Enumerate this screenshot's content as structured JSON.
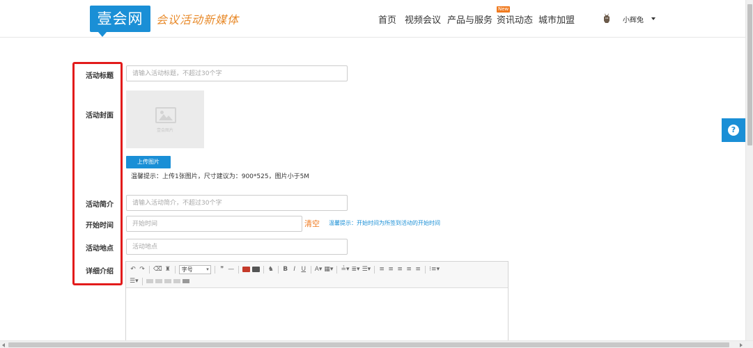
{
  "header": {
    "logo_text": "壹会网",
    "slogan": "会议活动新媒体",
    "nav": {
      "home": "首页",
      "video": "视频会议",
      "product": "产品与服务",
      "news": "资讯动态",
      "news_badge": "New",
      "city": "城市加盟"
    },
    "user": {
      "name": "小辉兔"
    }
  },
  "form": {
    "title_label": "活动标题",
    "title_placeholder": "请输入活动标题，不超过30个字",
    "cover_label": "活动封面",
    "cover_placeholder_text": "壹会图片",
    "upload_button": "上传图片",
    "upload_tip": "温馨提示：上传1张图片，尺寸建议为：900*525，图片小于5M",
    "intro_label": "活动简介",
    "intro_placeholder": "请输入活动简介，不超过30个字",
    "start_label": "开始时间",
    "start_placeholder": "开始时间",
    "clear_link": "清空",
    "start_tip": "温馨提示：开始时间为所签到活动的开始时间",
    "place_label": "活动地点",
    "place_placeholder": "活动地点",
    "detail_label": "详细介绍"
  },
  "editor": {
    "font_size_select": "字号",
    "toolbar_icons": [
      "undo-icon",
      "redo-icon",
      "eraser-icon",
      "format-brush-icon",
      "quote-icon",
      "horizontal-rule-icon",
      "image-icon",
      "video-icon",
      "map-marker-icon",
      "bold-icon",
      "italic-icon",
      "underline-icon",
      "font-color-icon",
      "background-color-icon",
      "row-spacing-icon",
      "paragraph-spacing-icon",
      "line-height-icon",
      "align-left-icon",
      "align-center-icon",
      "align-right-icon",
      "align-justify-icon",
      "indent-icon",
      "list-icon",
      "list-dropdown-icon",
      "table-icon",
      "insert-row-icon",
      "insert-col-icon",
      "merge-icon",
      "link-icon"
    ]
  },
  "help": {
    "label": "?"
  },
  "colors": {
    "brand_blue": "#1a8fd6",
    "accent_orange": "#f07a1f",
    "highlight_red": "#e21b1b"
  }
}
